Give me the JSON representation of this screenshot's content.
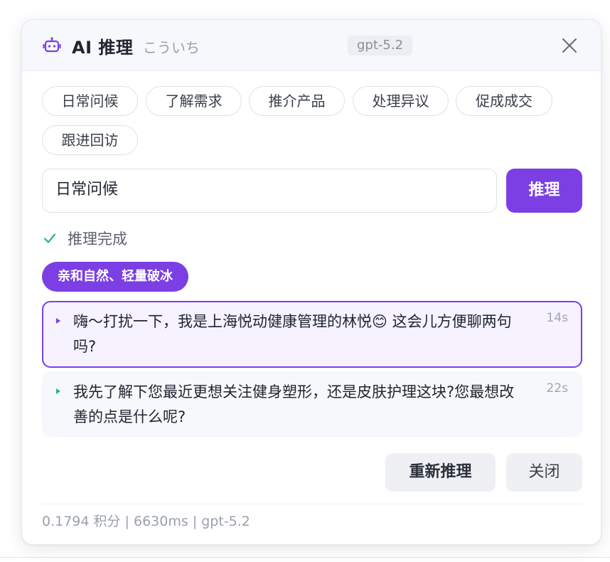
{
  "header": {
    "title": "AI 推理",
    "subtitle": "こういち",
    "model_badge": "gpt-5.2"
  },
  "scenarios": [
    {
      "label": "日常问候"
    },
    {
      "label": "了解需求"
    },
    {
      "label": "推介产品"
    },
    {
      "label": "处理异议"
    },
    {
      "label": "促成成交"
    },
    {
      "label": "跟进回访"
    }
  ],
  "input": {
    "value": "日常问候"
  },
  "reason_button_label": "推理",
  "status": {
    "text": "推理完成"
  },
  "style_tag": "亲和自然、轻量破冰",
  "suggestions": [
    {
      "text": "嗨～打扰一下，我是上海悦动健康管理的林悦😊 这会儿方便聊两句吗?",
      "time": "14s",
      "selected": true
    },
    {
      "text": "我先了解下您最近更想关注健身塑形，还是皮肤护理这块?您最想改善的点是什么呢?",
      "time": "22s",
      "selected": false
    }
  ],
  "actions": {
    "regenerate_label": "重新推理",
    "close_label": "关闭"
  },
  "footer": {
    "stats": "0.1794 积分 | 6630ms | gpt-5.2"
  },
  "colors": {
    "accent": "#7b3fe4",
    "success": "#2db37a",
    "muted": "#9aa0ab"
  }
}
